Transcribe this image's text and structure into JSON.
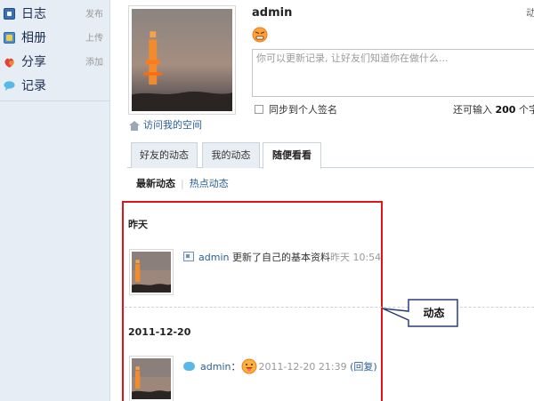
{
  "sidebar": {
    "items": [
      {
        "label": "日志",
        "action": "发布",
        "icon": "blog-icon"
      },
      {
        "label": "相册",
        "action": "上传",
        "icon": "album-icon"
      },
      {
        "label": "分享",
        "action": "添加",
        "icon": "share-icon"
      },
      {
        "label": "记录",
        "action": "",
        "icon": "record-icon"
      }
    ]
  },
  "profile": {
    "username": "admin",
    "visit_link": "访问我的空间",
    "right_cut_text": "动",
    "status_placeholder": "你可以更新记录, 让好友们知道你在做什么...",
    "sync_label": "同步到个人签名",
    "remaining_prefix": "还可输入",
    "remaining_count": "200",
    "remaining_suffix": "个字"
  },
  "tabs": [
    {
      "label": "好友的动态",
      "active": false
    },
    {
      "label": "我的动态",
      "active": false
    },
    {
      "label": "随便看看",
      "active": true
    }
  ],
  "subtabs": {
    "active": "最新动态",
    "other": "热点动态"
  },
  "feed": {
    "groups": [
      {
        "date": "昨天",
        "entry": {
          "user": "admin",
          "text": "更新了自己的基本资料",
          "time": "昨天 10:54"
        }
      },
      {
        "date": "2011-12-20",
        "entry": {
          "user": "admin",
          "separator": "：",
          "time": "2011-12-20 21:39",
          "reply": "(回复)"
        }
      }
    ]
  },
  "callout": {
    "label": "动态"
  },
  "colors": {
    "highlight_frame": "#e2141a",
    "link": "#2b5d9a",
    "sidebar_bg": "#e6edf4"
  }
}
